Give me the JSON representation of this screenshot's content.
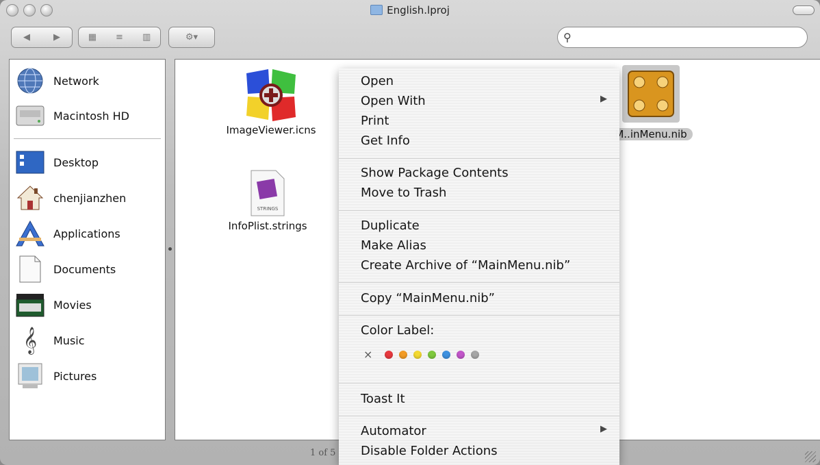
{
  "window": {
    "title": "English.lproj"
  },
  "toolbar": {
    "back_icon": "back-arrow-icon",
    "forward_icon": "forward-arrow-icon",
    "view_icons": [
      "icon-view-icon",
      "list-view-icon",
      "column-view-icon"
    ],
    "action_icon": "gear-icon",
    "search_placeholder": ""
  },
  "sidebar": {
    "items": [
      {
        "label": "Network",
        "icon": "network-globe-icon"
      },
      {
        "label": "Macintosh HD",
        "icon": "hard-drive-icon"
      },
      {
        "label": "Desktop",
        "icon": "desktop-icon"
      },
      {
        "label": "chenjianzhen",
        "icon": "home-icon"
      },
      {
        "label": "Applications",
        "icon": "applications-icon"
      },
      {
        "label": "Documents",
        "icon": "documents-icon"
      },
      {
        "label": "Movies",
        "icon": "movies-clapper-icon"
      },
      {
        "label": "Music",
        "icon": "music-clef-icon"
      },
      {
        "label": "Pictures",
        "icon": "pictures-frame-icon"
      }
    ]
  },
  "files": [
    {
      "label": "ImageViewer.icns",
      "icon": "icns-file-icon"
    },
    {
      "label": "InfoPlist.strings",
      "icon": "strings-file-icon",
      "badge": "STRINGS"
    },
    {
      "label": "MainMenu.nib",
      "visible_label": "M..inMenu.nib",
      "icon": "nib-file-icon"
    }
  ],
  "status": {
    "text": "1 of 5"
  },
  "context_menu": {
    "groups": [
      [
        "Open",
        "Open With",
        "Print",
        "Get Info"
      ],
      [
        "Show Package Contents",
        "Move to Trash"
      ],
      [
        "Duplicate",
        "Make Alias",
        "Create Archive of “MainMenu.nib”"
      ],
      [
        "Copy “MainMenu.nib”"
      ],
      [
        "Color Label:"
      ],
      [
        "Toast It"
      ],
      [
        "Automator",
        "Disable Folder Actions"
      ]
    ],
    "submenu_arrow": "▶",
    "no_label_symbol": "×",
    "label_colors": [
      "#e8363c",
      "#f39a21",
      "#f4d92c",
      "#7cc83a",
      "#3b8fe0",
      "#c153c9",
      "#a5a5a5"
    ]
  }
}
